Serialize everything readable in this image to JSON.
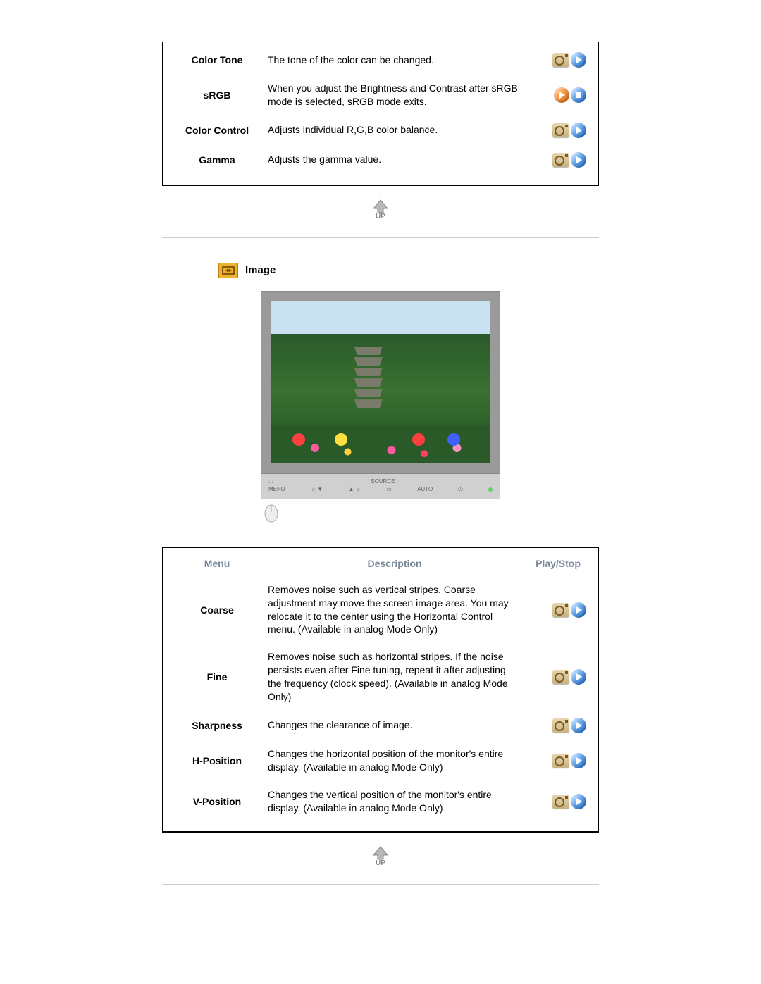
{
  "color_table": {
    "rows": [
      {
        "menu": "Color Tone",
        "desc": "The tone of the color can be changed.",
        "icons": [
          "cam",
          "play-blue"
        ]
      },
      {
        "menu": "sRGB",
        "desc": "When you adjust the Brightness and Contrast after sRGB mode is selected, sRGB mode exits.",
        "icons": [
          "play-orange",
          "stop"
        ]
      },
      {
        "menu": "Color Control",
        "desc": "Adjusts individual R,G,B color balance.",
        "icons": [
          "cam",
          "play-blue"
        ]
      },
      {
        "menu": "Gamma",
        "desc": "Adjusts the gamma value.",
        "icons": [
          "cam",
          "play-blue"
        ]
      }
    ]
  },
  "image_section": {
    "title": "Image"
  },
  "monitor_panel": {
    "menu_label": "MENU",
    "source_label": "SOURCE",
    "auto_label": "AUTO",
    "enter_symbol": "▭",
    "power_symbol": "⏻"
  },
  "image_table": {
    "headers": {
      "menu": "Menu",
      "desc": "Description",
      "play": "Play/Stop"
    },
    "rows": [
      {
        "menu": "Coarse",
        "desc": "Removes noise such as vertical stripes. Coarse adjustment may move the screen image area. You may relocate it to the center using the Horizontal Control menu. (Available in analog Mode Only)",
        "icons": [
          "cam",
          "play-blue"
        ]
      },
      {
        "menu": "Fine",
        "desc": "Removes noise such as horizontal stripes. If the noise persists even after Fine tuning, repeat it after adjusting the frequency (clock speed).\n(Available in analog Mode Only)",
        "icons": [
          "cam",
          "play-blue"
        ]
      },
      {
        "menu": "Sharpness",
        "desc": "Changes the clearance of image.",
        "icons": [
          "cam",
          "play-blue"
        ]
      },
      {
        "menu": "H-Position",
        "desc": "Changes the horizontal position of the monitor's entire display.\n(Available in analog Mode Only)",
        "icons": [
          "cam",
          "play-blue"
        ]
      },
      {
        "menu": "V-Position",
        "desc": "Changes the vertical position of the monitor's entire display.\n(Available in analog Mode Only)",
        "icons": [
          "cam",
          "play-blue"
        ]
      }
    ]
  },
  "up_label": "UP"
}
